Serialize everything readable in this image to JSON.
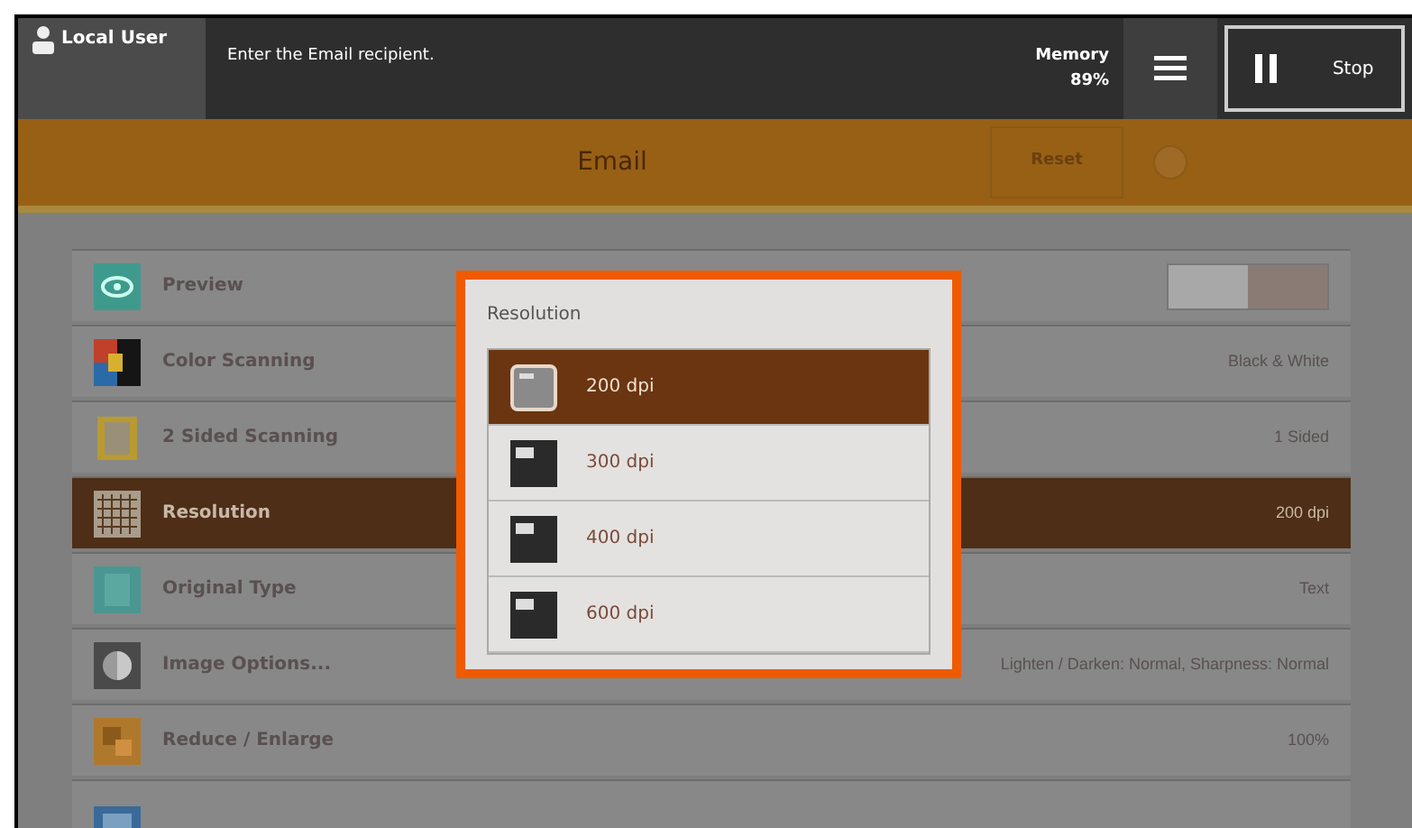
{
  "header": {
    "user": "Local User",
    "message": "Enter the Email recipient.",
    "memory_label": "Memory",
    "memory_value": "89%",
    "stop": "Stop"
  },
  "title_bar": {
    "title": "Email",
    "reset": "Reset"
  },
  "features": [
    {
      "label": "Preview",
      "kind": "toggle",
      "on": false,
      "selected": false
    },
    {
      "label": "Color Scanning",
      "kind": "value",
      "value": "Black & White",
      "selected": false
    },
    {
      "label": "2 Sided Scanning",
      "kind": "value",
      "value": "1 Sided",
      "selected": false
    },
    {
      "label": "Resolution",
      "kind": "value",
      "value": "200 dpi",
      "selected": true
    },
    {
      "label": "Original Type",
      "kind": "value",
      "value": "Text",
      "selected": false
    },
    {
      "label": "Image Options...",
      "kind": "value",
      "value": "Lighten / Darken: Normal, Sharpness: Normal",
      "selected": false
    },
    {
      "label": "Reduce / Enlarge",
      "kind": "value",
      "value": "100%",
      "selected": false
    },
    {
      "kind": "partial",
      "selected": false
    }
  ],
  "popup": {
    "title": "Resolution",
    "options": [
      {
        "label": "200 dpi",
        "selected": true
      },
      {
        "label": "300 dpi",
        "selected": false
      },
      {
        "label": "400 dpi",
        "selected": false
      },
      {
        "label": "600 dpi",
        "selected": false
      }
    ]
  }
}
